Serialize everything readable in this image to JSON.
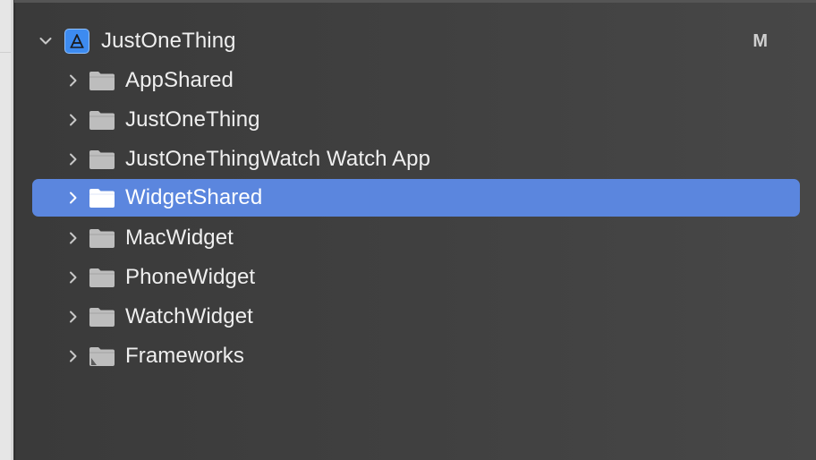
{
  "project": {
    "name": "JustOneThing",
    "status_badge": "M",
    "icon": "xcode-project-icon"
  },
  "folders": [
    {
      "label": "AppShared",
      "icon": "folder-icon",
      "selected": false
    },
    {
      "label": "JustOneThing",
      "icon": "folder-icon",
      "selected": false
    },
    {
      "label": "JustOneThingWatch Watch App",
      "icon": "folder-icon",
      "selected": false
    },
    {
      "label": "WidgetShared",
      "icon": "folder-icon",
      "selected": true
    },
    {
      "label": "MacWidget",
      "icon": "folder-icon",
      "selected": false
    },
    {
      "label": "PhoneWidget",
      "icon": "folder-icon",
      "selected": false
    },
    {
      "label": "WatchWidget",
      "icon": "folder-icon",
      "selected": false
    },
    {
      "label": "Frameworks",
      "icon": "framework-folder-icon",
      "selected": false
    }
  ],
  "colors": {
    "selection": "#5b86de",
    "folder": "#bdbdbd",
    "background": "#3b3b3b"
  }
}
